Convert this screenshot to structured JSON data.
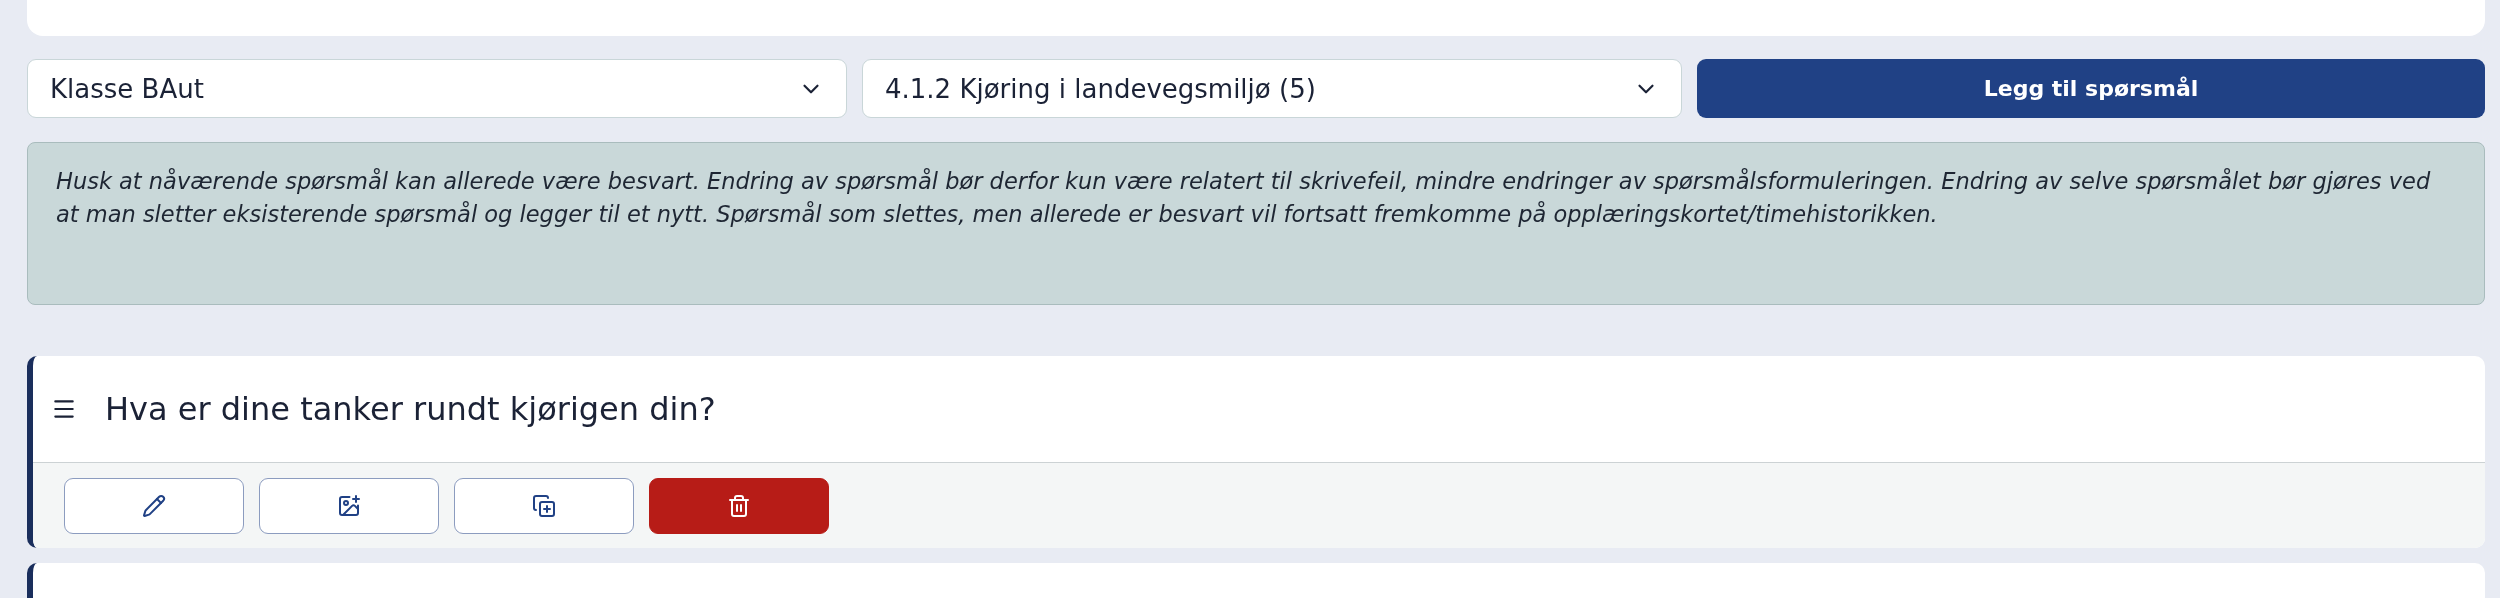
{
  "filters": [
    {
      "value": "Klasse BAut"
    },
    {
      "value": "4.1.2 Kjøring i landevegsmiljø (5)"
    }
  ],
  "add_button": {
    "label": "Legg til spørsmål"
  },
  "notice": "Husk at nåværende spørsmål kan allerede være besvart. Endring av spørsmål bør derfor kun være relatert til skrivefeil, mindre endringer av spørsmålsformuleringen. Endring av selve spørsmålet bør gjøres ved at man sletter eksisterende spørsmål og legger til et nytt. Spørsmål som slettes, men allerede er besvart vil fortsatt fremkomme på opplæringskortet/timehistorikken.",
  "questions": [
    {
      "text": "Hva er dine tanker rundt kjørigen din?",
      "actions": [
        {
          "kind": "edit"
        },
        {
          "kind": "image"
        },
        {
          "kind": "copy"
        },
        {
          "kind": "delete"
        }
      ]
    }
  ]
}
